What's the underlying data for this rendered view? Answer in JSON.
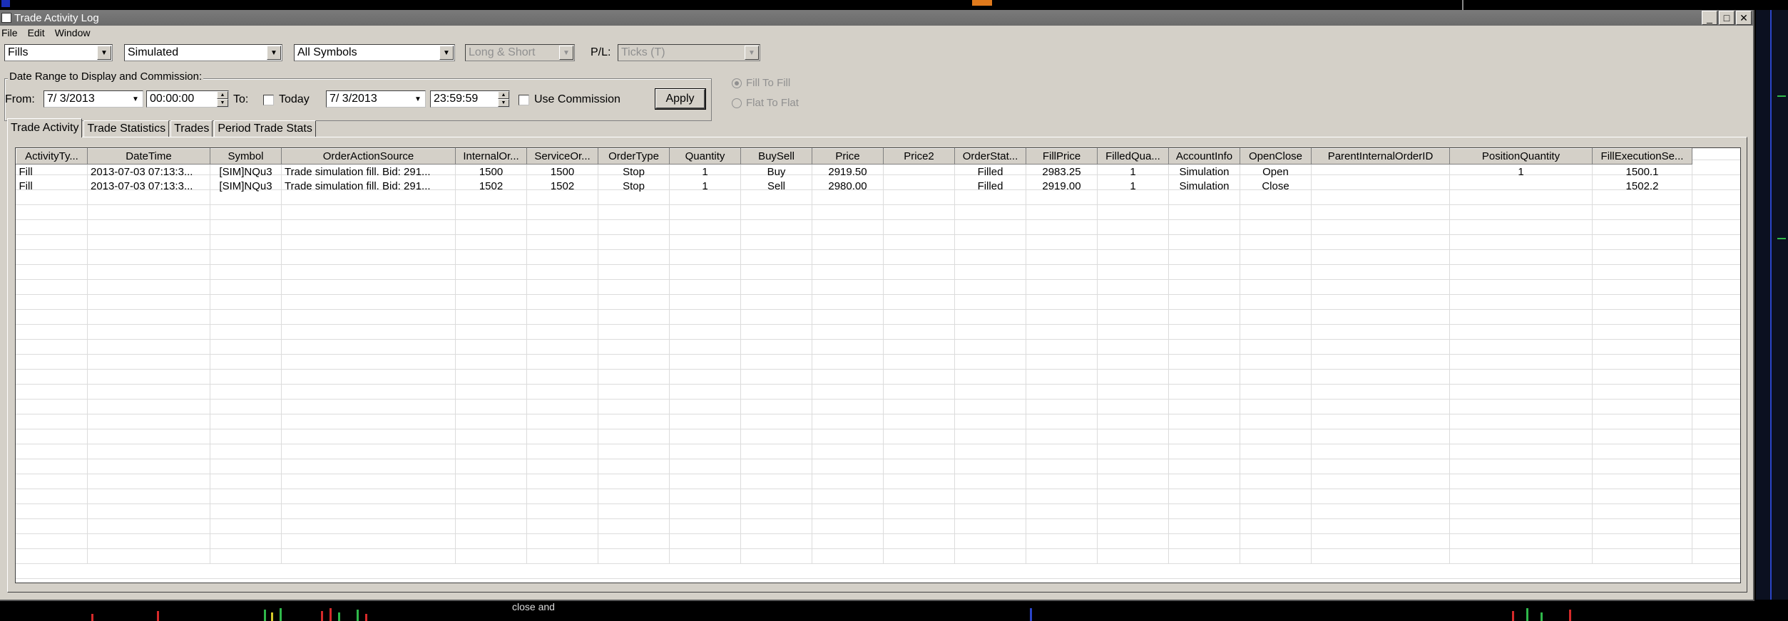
{
  "window": {
    "title": "Trade Activity Log"
  },
  "menu": [
    "File",
    "Edit",
    "Window"
  ],
  "filters": {
    "activity_type": "Fills",
    "mode": "Simulated",
    "symbols": "All Symbols",
    "side": "Long & Short",
    "pl_label": "P/L:",
    "pl_unit": "Ticks (T)"
  },
  "date_range": {
    "legend": "Date Range to Display and Commission:",
    "from_label": "From:",
    "from_date": "7/ 3/2013",
    "from_time": "00:00:00",
    "to_label": "To:",
    "today_label": "Today",
    "to_date": "7/ 3/2013",
    "to_time": "23:59:59",
    "use_commission_label": "Use Commission",
    "apply_label": "Apply"
  },
  "calc_mode": {
    "fill_to_fill": "Fill To Fill",
    "flat_to_flat": "Flat To Flat",
    "selected": "fill_to_fill"
  },
  "tabs": [
    "Trade Activity",
    "Trade Statistics",
    "Trades",
    "Period Trade Stats"
  ],
  "table": {
    "columns": [
      "ActivityTy...",
      "DateTime",
      "Symbol",
      "OrderActionSource",
      "InternalOr...",
      "ServiceOr...",
      "OrderType",
      "Quantity",
      "BuySell",
      "Price",
      "Price2",
      "OrderStat...",
      "FillPrice",
      "FilledQua...",
      "AccountInfo",
      "OpenClose",
      "ParentInternalOrderID",
      "PositionQuantity",
      "FillExecutionSe..."
    ],
    "rows": [
      [
        "Fill",
        "2013-07-03 07:13:3...",
        "[SIM]NQu3",
        "Trade simulation fill. Bid: 291...",
        "1500",
        "1500",
        "Stop",
        "1",
        "Buy",
        "2919.50",
        "",
        "Filled",
        "2983.25",
        "1",
        "Simulation",
        "Open",
        "",
        "1",
        "1500.1"
      ],
      [
        "Fill",
        "2013-07-03 07:13:3...",
        "[SIM]NQu3",
        "Trade simulation fill. Bid: 291...",
        "1502",
        "1502",
        "Stop",
        "1",
        "Sell",
        "2980.00",
        "",
        "Filled",
        "2919.00",
        "1",
        "Simulation",
        "Close",
        "",
        "",
        "1502.2"
      ]
    ]
  },
  "background": {
    "chart_text": "close and",
    "colors": {
      "up": "#2fb84a",
      "down": "#d62a2a",
      "line": "#2b45c8"
    }
  }
}
